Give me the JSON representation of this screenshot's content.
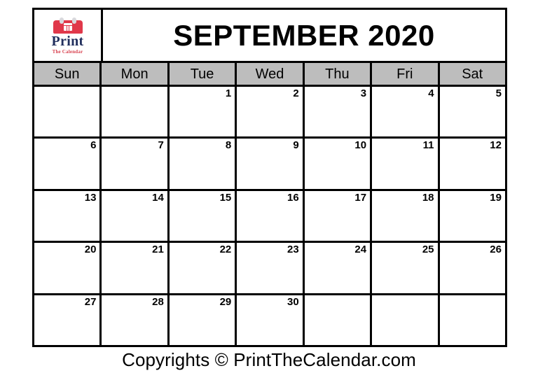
{
  "logo": {
    "icon_name": "calendar-icon",
    "wordmark": "Print",
    "tagline": "The Calendar",
    "icon_color": "#e0384a",
    "wordmark_color": "#22305e",
    "tagline_color": "#d8414f"
  },
  "header": {
    "title": "SEPTEMBER 2020",
    "month": "SEPTEMBER",
    "year": "2020"
  },
  "weekdays": [
    {
      "label": "Sun"
    },
    {
      "label": "Mon"
    },
    {
      "label": "Tue"
    },
    {
      "label": "Wed"
    },
    {
      "label": "Thu"
    },
    {
      "label": "Fri"
    },
    {
      "label": "Sat"
    }
  ],
  "weeks": [
    {
      "days": [
        {
          "num": ""
        },
        {
          "num": ""
        },
        {
          "num": "1"
        },
        {
          "num": "2"
        },
        {
          "num": "3"
        },
        {
          "num": "4"
        },
        {
          "num": "5"
        }
      ]
    },
    {
      "days": [
        {
          "num": "6"
        },
        {
          "num": "7"
        },
        {
          "num": "8"
        },
        {
          "num": "9"
        },
        {
          "num": "10"
        },
        {
          "num": "11"
        },
        {
          "num": "12"
        }
      ]
    },
    {
      "days": [
        {
          "num": "13"
        },
        {
          "num": "14"
        },
        {
          "num": "15"
        },
        {
          "num": "16"
        },
        {
          "num": "17"
        },
        {
          "num": "18"
        },
        {
          "num": "19"
        }
      ]
    },
    {
      "days": [
        {
          "num": "20"
        },
        {
          "num": "21"
        },
        {
          "num": "22"
        },
        {
          "num": "23"
        },
        {
          "num": "24"
        },
        {
          "num": "25"
        },
        {
          "num": "26"
        }
      ]
    },
    {
      "days": [
        {
          "num": "27"
        },
        {
          "num": "28"
        },
        {
          "num": "29"
        },
        {
          "num": "30"
        },
        {
          "num": ""
        },
        {
          "num": ""
        },
        {
          "num": ""
        }
      ]
    }
  ],
  "footer": {
    "copyright": "Copyrights © PrintTheCalendar.com"
  },
  "colors": {
    "weekday_header_bg": "#bdbdbd",
    "grid_line": "#000000",
    "cell_bg": "#ffffff",
    "page_bg": "#ffffff"
  }
}
